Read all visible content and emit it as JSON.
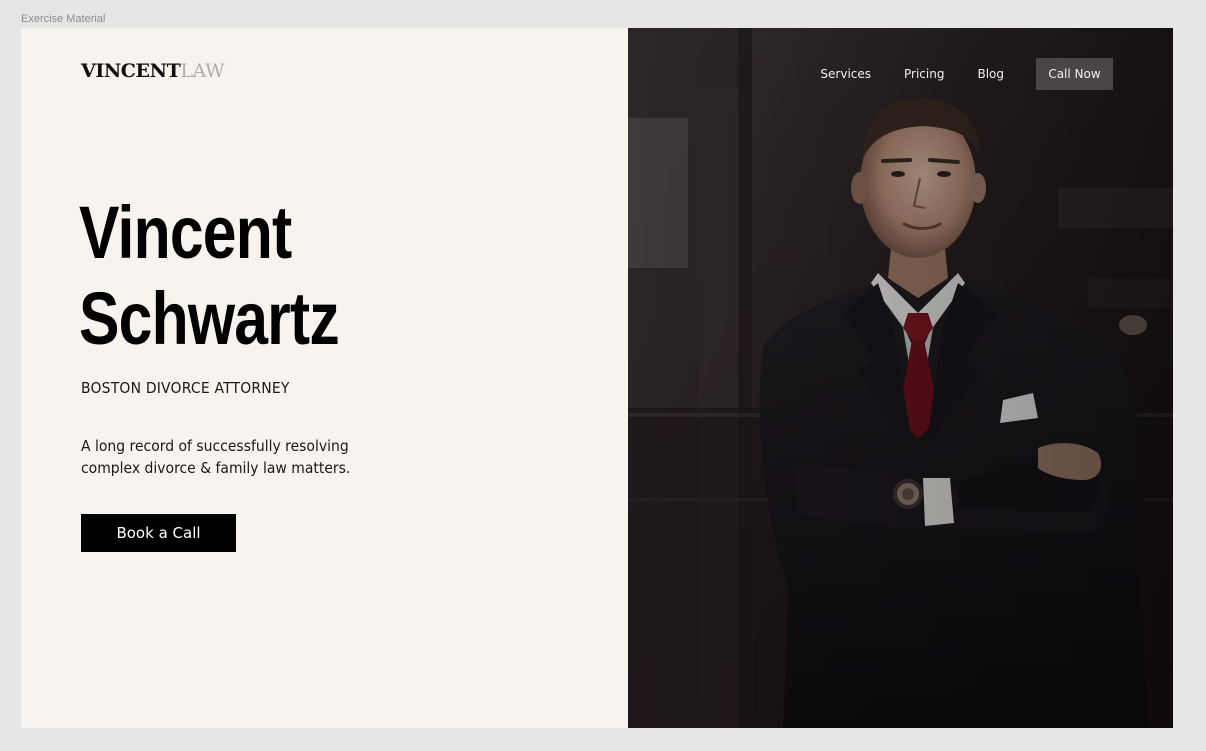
{
  "frame_label": "Exercise Material",
  "brand": {
    "strong": "VINCENT",
    "light": "LAW"
  },
  "nav": {
    "links": [
      "Services",
      "Pricing",
      "Blog"
    ],
    "call_button": "Call Now"
  },
  "hero": {
    "title_line1": "Vincent",
    "title_line2": "Schwartz",
    "subtitle": "BOSTON DIVORCE ATTORNEY",
    "description": "A long record of successfully resolving complex divorce & family law matters.",
    "cta_label": "Book a Call"
  },
  "colors": {
    "page_background": "#f7f3ee",
    "canvas_background": "#e6e6e6",
    "text": "#000000",
    "brand_light": "#b4aea8",
    "cta_background": "#000000",
    "call_button_background": "#4b4547",
    "photo_dark": "#1b1416",
    "tie": "#7d1420"
  }
}
